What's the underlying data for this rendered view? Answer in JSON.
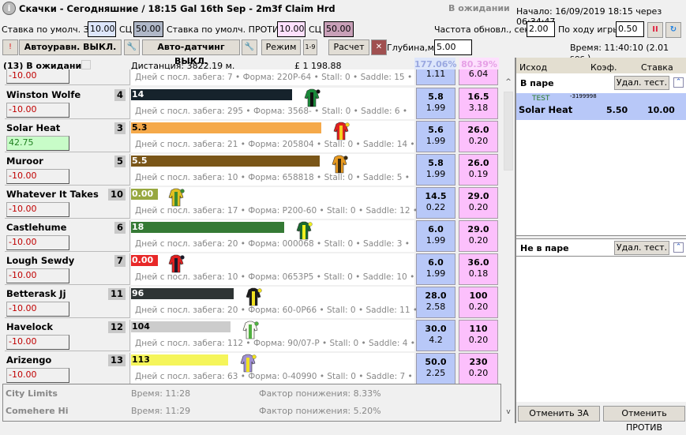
{
  "window": {
    "title": "Скачки - Сегодняшние / 18:15 Gal  16th Sep - 2m3f Claim Hrd",
    "status": "В ожидании",
    "start": "Начало: 16/09/2019 18:15 через 06:34:47"
  },
  "toolbar": {
    "back_stake_label": "Ставка по умолч. ЗА:",
    "back_stake": "10.00",
    "sc_label": "СЦ",
    "back_sc": "50.00",
    "lay_stake_label": "Ставка по умолч. ПРОТИВ:",
    "lay_stake": "10.00",
    "lay_sc": "50.00",
    "refresh_label": "Частота обновл., сек.",
    "refresh": "2.00",
    "inplay_label": "По ходу игры",
    "inplay": "0.50",
    "auto_equal": "Автоуравн. ВЫКЛ.",
    "auto_dutch": "Авто-датчинг ВЫКЛ.",
    "mode": "Режим",
    "calc": "Расчет",
    "depth_label": "Глубина,мин.:",
    "depth": "5.00",
    "time": "Время: 11:40:10 (2.01 sec.)"
  },
  "market": {
    "runners": "(13) В ожидании",
    "distance": "Дистанция: 3822.19 м.",
    "matched": "£ 1 198.88",
    "back_pct": "177.06%",
    "lay_pct": "80.39%"
  },
  "runners": [
    {
      "name": "",
      "no": "",
      "stake": "-10.00",
      "bar": "",
      "bar_color": "#ffffff",
      "info": "Дней с посл. забега: 7 • Форма: 220P-64 • Stall: 0 • Saddle: 15 •",
      "back": "",
      "back_vol": "1.11",
      "lay": "",
      "lay_vol": "6.04"
    },
    {
      "name": "Winston Wolfe",
      "no": "4",
      "stake": "-10.00",
      "bar": "14",
      "bar_color": "#16232c",
      "info": "Дней с посл. забега: 295 • Форма: 3568- • Stall: 0 • Saddle: 6 •",
      "back": "5.8",
      "back_vol": "1.99",
      "lay": "16.5",
      "lay_vol": "3.18",
      "jersey": [
        "#1a8a3a",
        "#111111"
      ]
    },
    {
      "name": "Solar Heat",
      "no": "3",
      "stake": "42.75",
      "stake_positive": true,
      "bar": "5.3",
      "bar_color": "#f5a94a",
      "info": "Дней с посл. забега: 21 • Форма: 205804 • Stall: 0 • Saddle: 14 •",
      "back": "5.6",
      "back_vol": "1.99",
      "lay": "26.0",
      "lay_vol": "0.20",
      "jersey": [
        "#e02020",
        "#f5d020"
      ]
    },
    {
      "name": "Muroor",
      "no": "5",
      "stake": "-10.00",
      "bar": "5.5",
      "bar_color": "#7a5618",
      "info": "Дней с посл. забега: 10 • Форма: 658818 • Stall: 0 • Saddle: 5 •",
      "back": "5.8",
      "back_vol": "1.99",
      "lay": "26.0",
      "lay_vol": "0.19",
      "jersey": [
        "#e89a20",
        "#3a2a10"
      ]
    },
    {
      "name": "Whatever It Takes",
      "no": "10",
      "stake": "-10.00",
      "bar": "0.00",
      "bar_color": "#98a840",
      "info": "Дней с посл. забега: 17 • Форма: P200-60 • Stall: 0 • Saddle: 12 •",
      "back": "14.5",
      "back_vol": "0.22",
      "lay": "29.0",
      "lay_vol": "0.20",
      "jersey": [
        "#e0c020",
        "#3a8a30"
      ]
    },
    {
      "name": "Castlehume",
      "no": "6",
      "stake": "-10.00",
      "bar": "18",
      "bar_color": "#357a35",
      "info": "Дней с посл. забега: 20 • Форма: 000068 • Stall: 0 • Saddle: 3 •",
      "back": "6.0",
      "back_vol": "1.99",
      "lay": "29.0",
      "lay_vol": "0.20",
      "jersey": [
        "#1a6a30",
        "#f0f020"
      ]
    },
    {
      "name": "Lough Sewdy",
      "no": "7",
      "stake": "-10.00",
      "bar": "0.00",
      "bar_color": "#e82828",
      "info": "Дней с посл. забега: 10 • Форма: 0653P5 • Stall: 0 • Saddle: 10 •",
      "back": "6.0",
      "back_vol": "1.99",
      "lay": "36.0",
      "lay_vol": "0.18",
      "jersey": [
        "#e02020",
        "#1a1a2a"
      ]
    },
    {
      "name": "Betterask Jj",
      "no": "11",
      "stake": "-10.00",
      "bar": "96",
      "bar_color": "#2e3434",
      "info": "Дней с посл. забега: 20 • Форма: 60-0P66 • Stall: 0 • Saddle: 11 •",
      "back": "28.0",
      "back_vol": "2.58",
      "lay": "100",
      "lay_vol": "0.20",
      "jersey": [
        "#1a1a1a",
        "#f0e020"
      ]
    },
    {
      "name": "Havelock",
      "no": "12",
      "stake": "-10.00",
      "bar": "104",
      "bar_color": "#cccccc",
      "info": "Дней с посл. забега: 112 • Форма: 90/07-P • Stall: 0 • Saddle: 4 •",
      "back": "30.0",
      "back_vol": "4.2",
      "lay": "110",
      "lay_vol": "0.20",
      "jersey": [
        "#f8f8f0",
        "#50b040"
      ]
    },
    {
      "name": "Arizengo",
      "no": "13",
      "stake": "-10.00",
      "bar": "113",
      "bar_color": "#f5f55a",
      "info": "Дней с посл. забега: 63 • Форма: 0-40990 • Stall: 0 • Saddle: 7 •",
      "back": "50.0",
      "back_vol": "2.25",
      "lay": "230",
      "lay_vol": "0.20",
      "jersey": [
        "#a090d0",
        "#f0e020"
      ]
    }
  ],
  "non_runners": [
    {
      "name": "City Limits",
      "time": "Время: 11:28",
      "factor": "Фактор понижения: 8.33%"
    },
    {
      "name": "Comehere Hi",
      "time": "Время: 11:29",
      "factor": "Фактор понижения: 5.20%"
    }
  ],
  "bets": {
    "col_outcome": "Исход",
    "col_odds": "Коэф.",
    "col_stake": "Ставка",
    "matched_title": "В паре",
    "remove_test": "Удал. тест.",
    "matched": [
      {
        "tag": "TEST",
        "id": "-3199998",
        "name": "Solar Heat",
        "odds": "5.50",
        "stake": "10.00"
      }
    ],
    "unmatched_title": "Не в паре",
    "cancel_back": "Отменить ЗА",
    "cancel_lay": "Отменить ПРОТИВ"
  }
}
